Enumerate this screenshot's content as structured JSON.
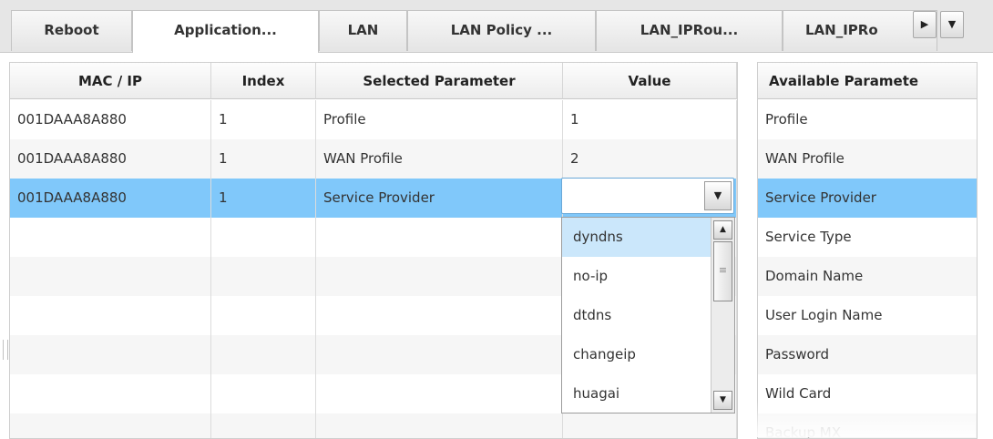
{
  "tabs": [
    {
      "label": "Reboot"
    },
    {
      "label": "Application..."
    },
    {
      "label": "LAN"
    },
    {
      "label": "LAN Policy ..."
    },
    {
      "label": "LAN_IPRou..."
    },
    {
      "label": "LAN_IPRo"
    }
  ],
  "tab_scroll": {
    "right_glyph": "▶",
    "menu_glyph": "▼"
  },
  "main_grid": {
    "columns": [
      "MAC / IP",
      "Index",
      "Selected Parameter",
      "Value"
    ],
    "rows": [
      {
        "mac": "001DAAA8A880",
        "index": "1",
        "param": "Profile",
        "value": "1"
      },
      {
        "mac": "001DAAA8A880",
        "index": "1",
        "param": "WAN Profile",
        "value": "2"
      },
      {
        "mac": "001DAAA8A880",
        "index": "1",
        "param": "Service Provider",
        "value": ""
      }
    ]
  },
  "value_editor": {
    "current_value": "",
    "button_glyph": "▼",
    "options": [
      "dyndns",
      "no-ip",
      "dtdns",
      "changeip",
      "huagai"
    ],
    "highlighted_option": "dyndns",
    "scroll_up_glyph": "▲",
    "scroll_down_glyph": "▼",
    "thumb_glyph": "≡"
  },
  "available_grid": {
    "header": "Available Paramete",
    "items": [
      "Profile",
      "WAN Profile",
      "Service Provider",
      "Service Type",
      "Domain Name",
      "User Login Name",
      "Password",
      "Wild Card",
      "Backup MX"
    ],
    "selected_item": "Service Provider"
  },
  "colors": {
    "selection": "#80c8fa",
    "option_highlight": "#cbe7fb",
    "combo_border": "#6aa8d8"
  }
}
